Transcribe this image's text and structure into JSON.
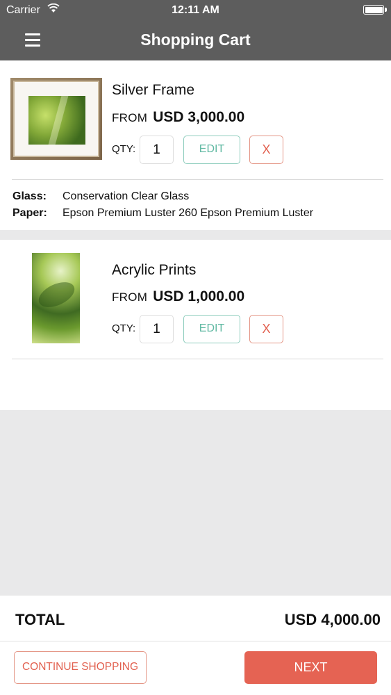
{
  "status_bar": {
    "carrier": "Carrier",
    "time": "12:11 AM"
  },
  "header": {
    "title": "Shopping Cart",
    "menu_icon": "hamburger-menu-icon"
  },
  "cart": {
    "items": [
      {
        "name": "Silver Frame",
        "from_label": "FROM",
        "price": "USD 3,000.00",
        "qty_label": "QTY:",
        "qty": "1",
        "edit_label": "EDIT",
        "remove_label": "X",
        "options": [
          {
            "key": "Glass:",
            "value": "Conservation Clear Glass"
          },
          {
            "key": "Paper:",
            "value": "Epson Premium Luster 260 Epson Premium Luster"
          }
        ]
      },
      {
        "name": "Acrylic Prints",
        "from_label": "FROM",
        "price": "USD 1,000.00",
        "qty_label": "QTY:",
        "qty": "1",
        "edit_label": "EDIT",
        "remove_label": "X"
      }
    ]
  },
  "total": {
    "label": "TOTAL",
    "value": "USD 4,000.00"
  },
  "footer": {
    "continue_label": "CONTINUE SHOPPING",
    "next_label": "NEXT"
  },
  "colors": {
    "header_bg": "#5d5d5d",
    "accent_red": "#e56353",
    "edit_teal": "#5fb8a2",
    "page_gray": "#e9e9ea"
  }
}
